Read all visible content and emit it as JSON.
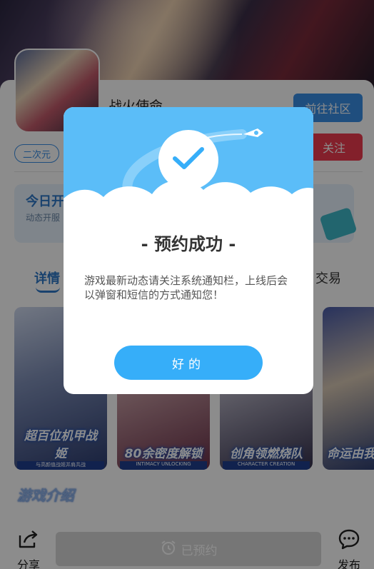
{
  "game": {
    "title": "战火使命",
    "tag": "二次元",
    "community_button": "前往社区",
    "follow_button": "关注"
  },
  "feature_card": {
    "title": "今日开",
    "subtitle": "动态开服"
  },
  "tabs": {
    "detail": "详情",
    "trade": "交易"
  },
  "screenshots": [
    {
      "caption": "超百位机甲战姬",
      "sub": "与高颜值战姬并肩共战"
    },
    {
      "caption": "80余密度解锁",
      "sub": "INTIMACY UNLOCKING"
    },
    {
      "caption": "创角领燃烧队",
      "sub": "CHARACTER CREATION"
    },
    {
      "caption": "命运由我",
      "sub": ""
    }
  ],
  "section_heading": "游戏介绍",
  "bottom_bar": {
    "share_label": "分享",
    "reserved_label": "已预约",
    "publish_label": "发布"
  },
  "dialog": {
    "title": "- 预约成功 -",
    "message": "游戏最新动态请关注系统通知栏，上线后会以弹窗和短信的方式通知您！",
    "ok_button": "好的"
  },
  "colors": {
    "accent_blue": "#36aef9",
    "banner_blue": "#5bbdf8",
    "follow_red": "#ef3b4f"
  },
  "icons": {
    "dialog": "checkmark-icon",
    "share": "share-icon",
    "reserved": "alarm-clock-icon",
    "publish": "chat-bubble-icon"
  }
}
